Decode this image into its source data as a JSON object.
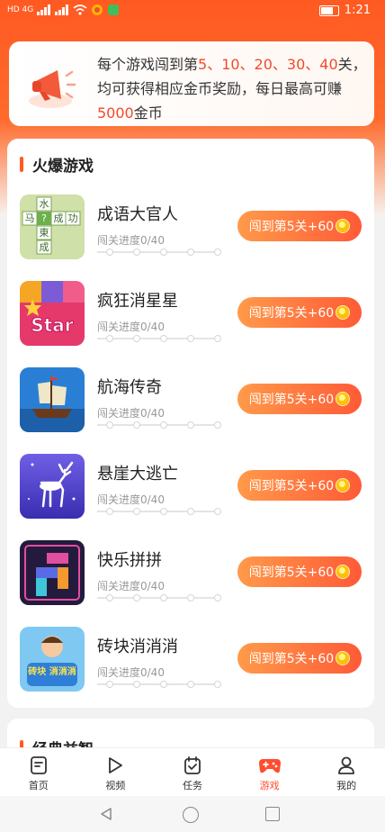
{
  "status_bar": {
    "time": "1:21",
    "carrier_tags": "HD 4G"
  },
  "notice": {
    "line1_prefix": "每个游戏闯到第",
    "levels": "5、10、20、30、40",
    "line1_suffix": "关，",
    "line2": "均可获得相应金币奖励，每日最高可赚",
    "amount": "5000",
    "unit": "金币"
  },
  "hot_section": {
    "title": "火爆游戏"
  },
  "games": [
    {
      "name": "成语大官人",
      "progress": "闯关进度0/40",
      "button": "闯到第5关+60",
      "progress_fraction": 0
    },
    {
      "name": "疯狂消星星",
      "progress": "闯关进度0/40",
      "button": "闯到第5关+60",
      "progress_fraction": 0
    },
    {
      "name": "航海传奇",
      "progress": "闯关进度0/40",
      "button": "闯到第5关+60",
      "progress_fraction": 0
    },
    {
      "name": "悬崖大逃亡",
      "progress": "闯关进度0/40",
      "button": "闯到第5关+60",
      "progress_fraction": 0
    },
    {
      "name": "快乐拼拼",
      "progress": "闯关进度0/40",
      "button": "闯到第5关+60",
      "progress_fraction": 0
    },
    {
      "name": "砖块消消消",
      "progress": "闯关进度0/40",
      "button": "闯到第5关+60",
      "progress_fraction": 0
    }
  ],
  "thumb_text": {
    "idiom": [
      "水",
      "马",
      "?",
      "成",
      "功",
      "東",
      "成"
    ],
    "star": "Star",
    "brick": "砖块 消消消"
  },
  "classic_section": {
    "title": "经典益智"
  },
  "tabbar": [
    {
      "label": "首页",
      "icon": "home-doc-icon"
    },
    {
      "label": "视频",
      "icon": "play-icon"
    },
    {
      "label": "任务",
      "icon": "calendar-check-icon"
    },
    {
      "label": "游戏",
      "icon": "gamepad-icon",
      "active": true
    },
    {
      "label": "我的",
      "icon": "user-icon"
    }
  ],
  "colors": {
    "accent": "#ff4d2e",
    "header_top": "#ff5a22",
    "button_start": "#ff9a4a",
    "button_end": "#ff5a37"
  }
}
